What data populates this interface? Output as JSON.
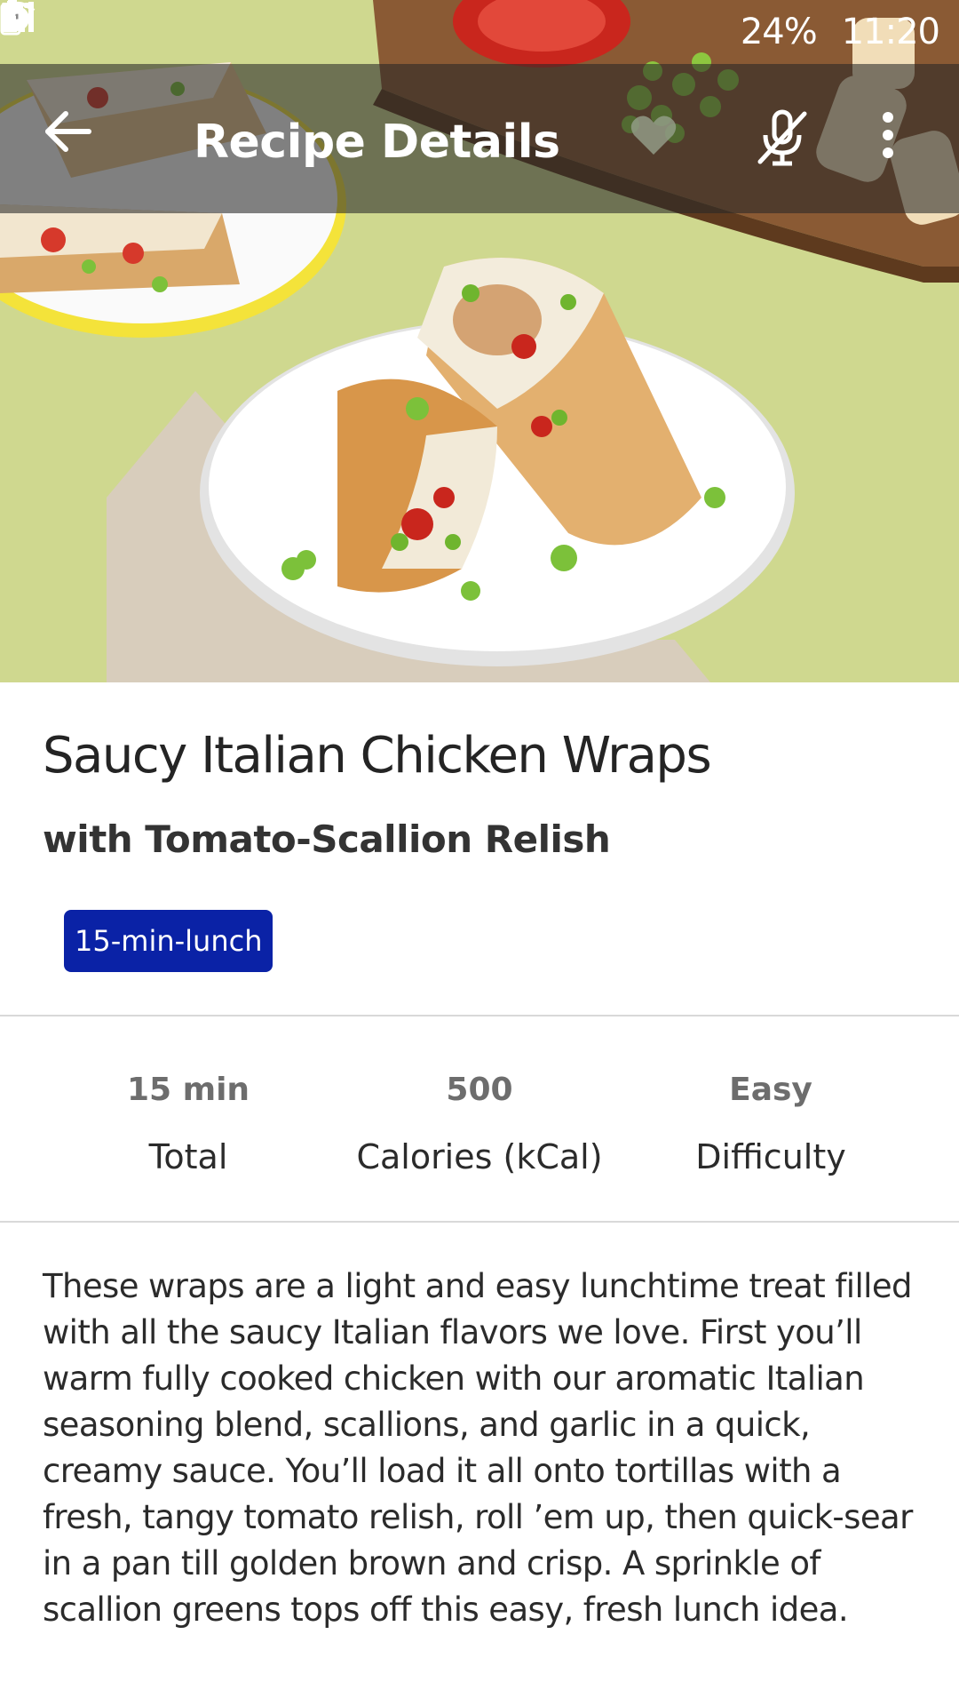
{
  "status_bar": {
    "battery_percent": "24%",
    "time": "11:20"
  },
  "app_bar": {
    "title": "Recipe Details"
  },
  "recipe": {
    "title": "Saucy Italian Chicken Wraps",
    "subtitle": "with Tomato-Scallion Relish",
    "tag": "15-min-lunch",
    "stats": [
      {
        "value": "15 min",
        "label": "Total"
      },
      {
        "value": "500",
        "label": "Calories (kCal)"
      },
      {
        "value": "Easy",
        "label": "Difficulty"
      }
    ],
    "description": "These wraps are a light and easy lunchtime treat filled with all the saucy Italian flavors we love. First you’ll warm fully cooked chicken with our aromatic Italian seasoning blend, scallions, and garlic in a quick, creamy sauce. You’ll load it all onto tortillas with a fresh, tangy tomato relish, roll ’em up, then quick-sear in a pan till golden brown and crisp. A sprinkle of scallion greens tops off this easy, fresh lunch idea."
  },
  "colors": {
    "tag_background": "#0a22a6",
    "hero_background": "#cfd88f",
    "app_bar_overlay": "rgba(40,40,40,0.58)"
  },
  "icons": {
    "back": "arrow-left-icon",
    "favorite": "heart-icon",
    "voice": "mic-off-icon",
    "more": "more-vertical-icon"
  }
}
